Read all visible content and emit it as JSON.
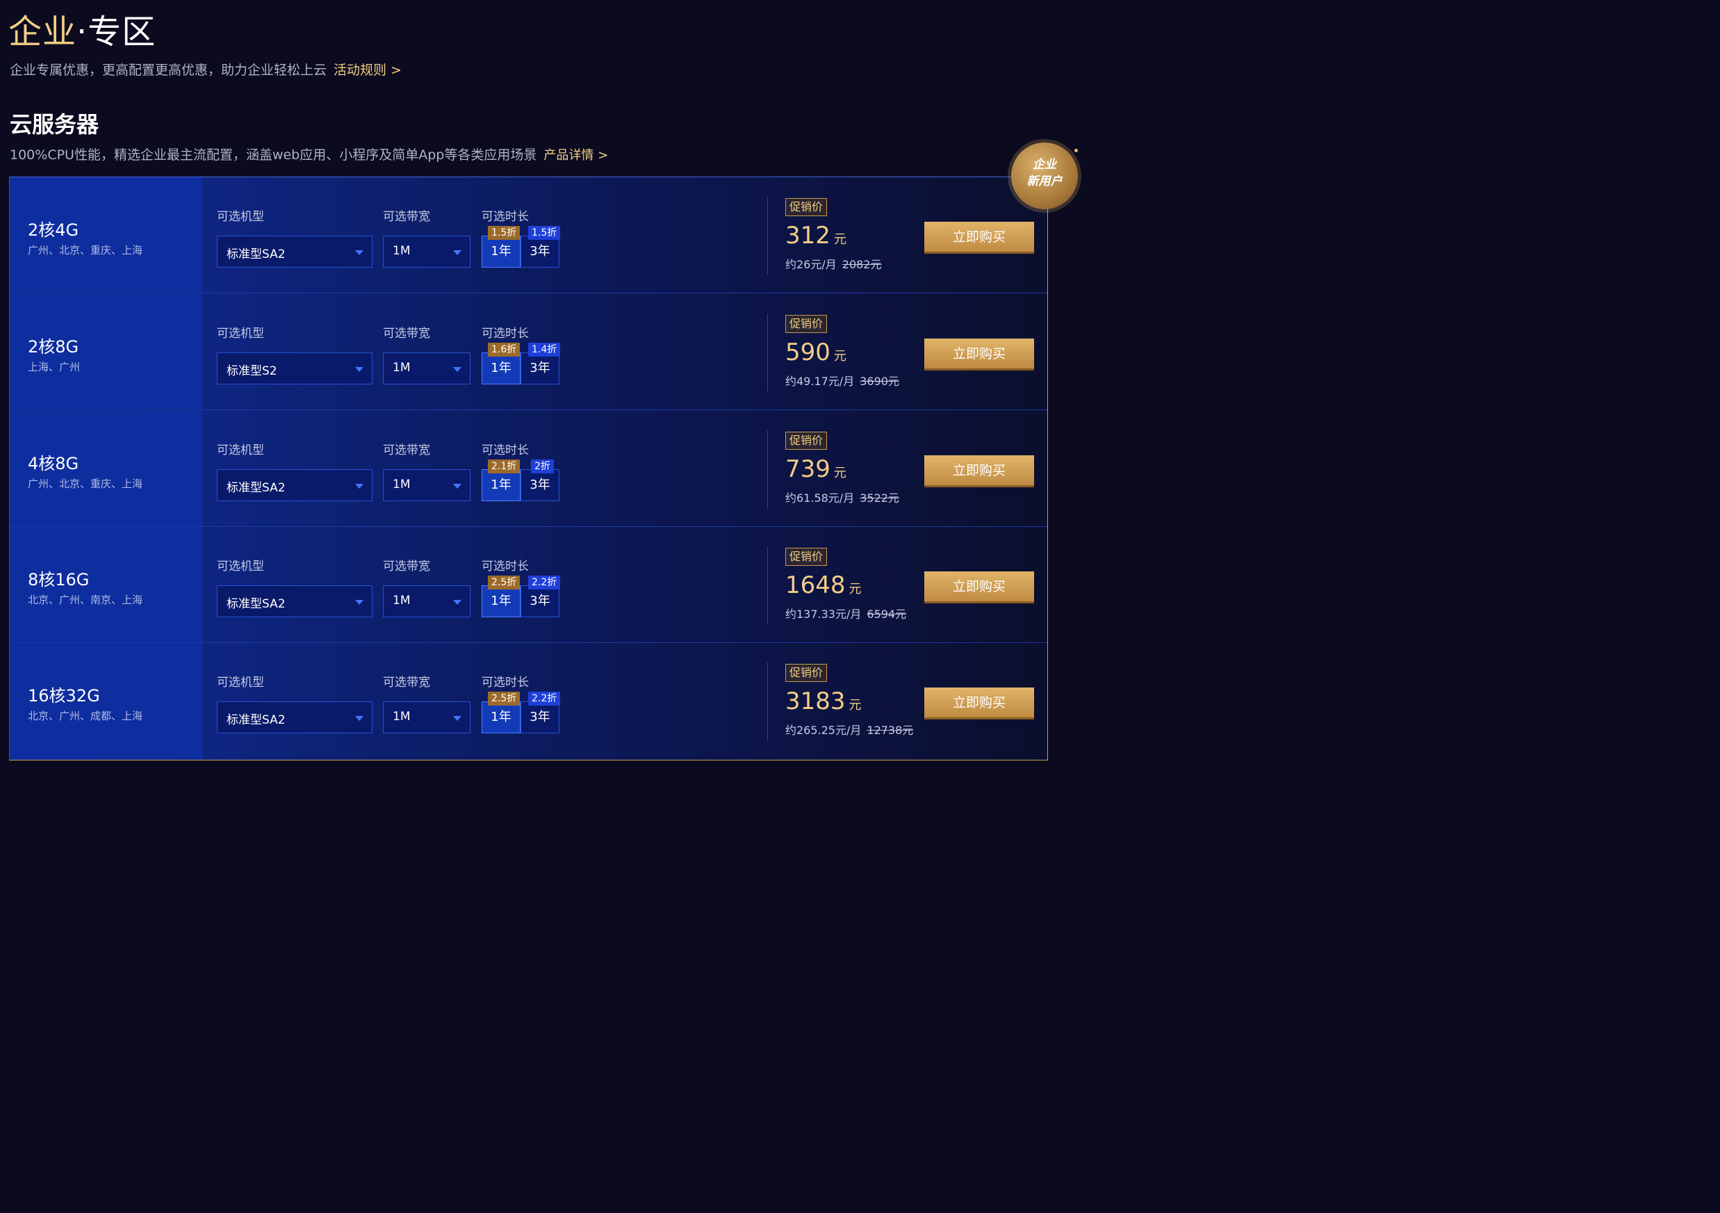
{
  "header": {
    "title_part1": "企业",
    "title_part2": "·专区",
    "subtitle": "企业专属优惠，更高配置更高优惠，助力企业轻松上云",
    "rules_link": "活动规则 >"
  },
  "section": {
    "title": "云服务器",
    "subtitle": "100%CPU性能，精选企业最主流配置，涵盖web应用、小程序及简单App等各类应用场景",
    "detail_link": "产品详情 >"
  },
  "badge": {
    "line1": "企业",
    "line2": "新用户"
  },
  "labels": {
    "model": "可选机型",
    "bandwidth": "可选带宽",
    "duration": "可选时长",
    "promo": "促销价",
    "yuan": "元",
    "buy": "立即购买"
  },
  "products": [
    {
      "name": "2核4G",
      "regions": "广州、北京、重庆、上海",
      "model": "标准型SA2",
      "bandwidth": "1M",
      "durations": [
        {
          "label": "1年",
          "discount": "1.5折",
          "selected": true
        },
        {
          "label": "3年",
          "discount": "1.5折",
          "selected": false
        }
      ],
      "price": "312",
      "monthly": "约26元/月",
      "original": "2082元"
    },
    {
      "name": "2核8G",
      "regions": "上海、广州",
      "model": "标准型S2",
      "bandwidth": "1M",
      "durations": [
        {
          "label": "1年",
          "discount": "1.6折",
          "selected": true
        },
        {
          "label": "3年",
          "discount": "1.4折",
          "selected": false
        }
      ],
      "price": "590",
      "monthly": "约49.17元/月",
      "original": "3690元"
    },
    {
      "name": "4核8G",
      "regions": "广州、北京、重庆、上海",
      "model": "标准型SA2",
      "bandwidth": "1M",
      "durations": [
        {
          "label": "1年",
          "discount": "2.1折",
          "selected": true
        },
        {
          "label": "3年",
          "discount": "2折",
          "selected": false
        }
      ],
      "price": "739",
      "monthly": "约61.58元/月",
      "original": "3522元"
    },
    {
      "name": "8核16G",
      "regions": "北京、广州、南京、上海",
      "model": "标准型SA2",
      "bandwidth": "1M",
      "durations": [
        {
          "label": "1年",
          "discount": "2.5折",
          "selected": true
        },
        {
          "label": "3年",
          "discount": "2.2折",
          "selected": false
        }
      ],
      "price": "1648",
      "monthly": "约137.33元/月",
      "original": "6594元"
    },
    {
      "name": "16核32G",
      "regions": "北京、广州、成都、上海",
      "model": "标准型SA2",
      "bandwidth": "1M",
      "durations": [
        {
          "label": "1年",
          "discount": "2.5折",
          "selected": true
        },
        {
          "label": "3年",
          "discount": "2.2折",
          "selected": false
        }
      ],
      "price": "3183",
      "monthly": "约265.25元/月",
      "original": "12738元"
    }
  ]
}
